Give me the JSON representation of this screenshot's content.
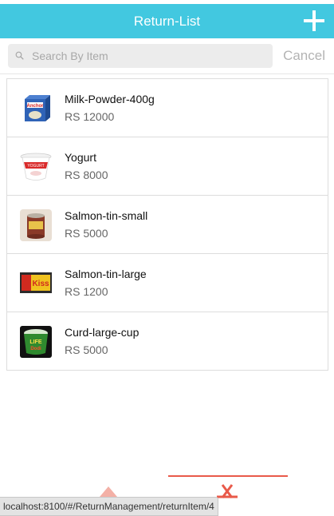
{
  "header": {
    "title": "Return-List"
  },
  "search": {
    "placeholder": "Search By Item",
    "cancel_label": "Cancel"
  },
  "items": [
    {
      "name": "Milk-Powder-400g",
      "price": "RS 12000",
      "icon": "milk-powder-box-icon"
    },
    {
      "name": "Yogurt",
      "price": "RS 8000",
      "icon": "yogurt-cup-icon"
    },
    {
      "name": "Salmon-tin-small",
      "price": "RS 5000",
      "icon": "small-tin-can-icon"
    },
    {
      "name": "Salmon-tin-large",
      "price": "RS 1200",
      "icon": "large-tin-can-icon"
    },
    {
      "name": "Curd-large-cup",
      "price": "RS 5000",
      "icon": "curd-cup-icon"
    }
  ],
  "tabbar": {
    "icons": [
      "arrow-up-icon",
      "close-x-icon"
    ],
    "accent": "#e95a4a"
  },
  "status_url": "localhost:8100/#/ReturnManagement/returnItem/4",
  "colors": {
    "header": "#42c8e0",
    "accent": "#e95a4a"
  }
}
